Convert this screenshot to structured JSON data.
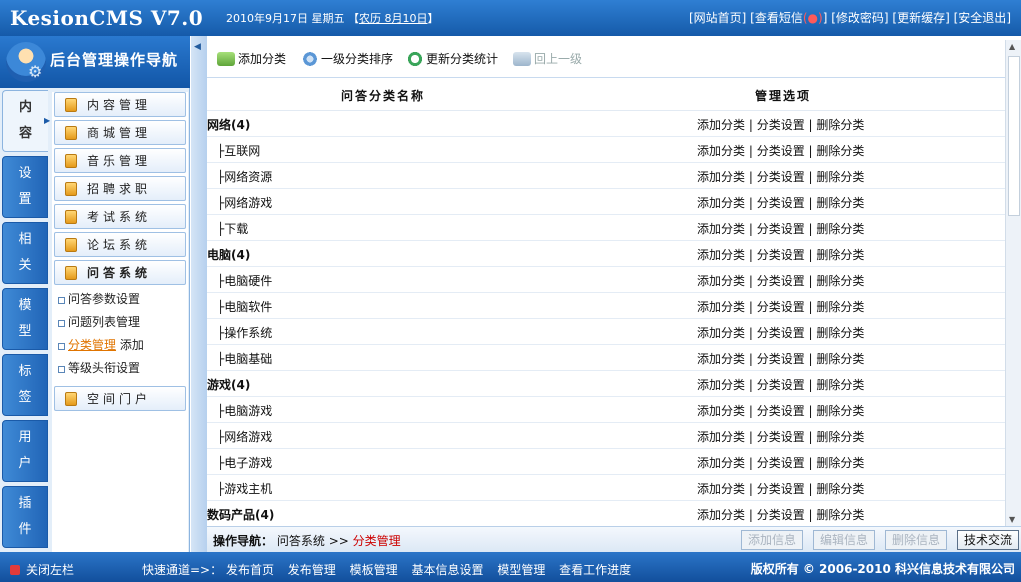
{
  "header": {
    "logo": "KesionCMS V7.0",
    "date": "2010年9月17日 星期五",
    "lunar_open": "【",
    "lunar": "农历 8月10日",
    "lunar_close": "】",
    "links": [
      "网站首页",
      "查看短信",
      "修改密码",
      "更新缓存",
      "安全退出"
    ]
  },
  "nav": {
    "title": "后台管理操作导航",
    "tabs": [
      {
        "top": "内",
        "bottom": "容"
      },
      {
        "top": "设",
        "bottom": "置"
      },
      {
        "top": "相",
        "bottom": "关"
      },
      {
        "top": "模",
        "bottom": "型"
      },
      {
        "top": "标",
        "bottom": "签"
      },
      {
        "top": "用",
        "bottom": "户"
      },
      {
        "top": "插",
        "bottom": "件"
      }
    ],
    "menu": [
      "内容管理",
      "商城管理",
      "音乐管理",
      "招聘求职",
      "考试系统",
      "论坛系统",
      "问答系统"
    ],
    "submenu": [
      "问答参数设置",
      "问题列表管理",
      "分类管理",
      "添加",
      "等级头衔设置"
    ],
    "menu_last": "空间门户"
  },
  "toolbar": {
    "add": "添加分类",
    "sort": "一级分类排序",
    "refresh": "更新分类统计",
    "up": "回上一级",
    "colors": {
      "add": "#7cc14a",
      "sort": "#5b97d6",
      "refresh": "#3aa55a",
      "up": "#9db5cc"
    }
  },
  "table": {
    "col_name": "问答分类名称",
    "col_ops": "管理选项",
    "op_add": "添加分类",
    "op_set": "分类设置",
    "op_del": "删除分类",
    "rows": [
      {
        "type": "parent",
        "name": "网络(4)"
      },
      {
        "type": "child",
        "name": "├互联网"
      },
      {
        "type": "child",
        "name": "├网络资源"
      },
      {
        "type": "child",
        "name": "├网络游戏"
      },
      {
        "type": "child",
        "name": "├下载"
      },
      {
        "type": "parent",
        "name": "电脑(4)"
      },
      {
        "type": "child",
        "name": "├电脑硬件"
      },
      {
        "type": "child",
        "name": "├电脑软件"
      },
      {
        "type": "child",
        "name": "├操作系统"
      },
      {
        "type": "child",
        "name": "├电脑基础"
      },
      {
        "type": "parent",
        "name": "游戏(4)"
      },
      {
        "type": "child",
        "name": "├电脑游戏"
      },
      {
        "type": "child",
        "name": "├网络游戏"
      },
      {
        "type": "child",
        "name": "├电子游戏"
      },
      {
        "type": "child",
        "name": "├游戏主机"
      },
      {
        "type": "parent",
        "name": "数码产品(4)"
      }
    ]
  },
  "actionbar": {
    "label": "操作导航：",
    "path": "问答系统",
    "sep": ">>",
    "current": "分类管理",
    "buttons": [
      "添加信息",
      "编辑信息",
      "删除信息",
      "技术交流"
    ]
  },
  "footer": {
    "close": "关闭左栏",
    "quick_label": "快速通道=>：",
    "quick": [
      "发布首页",
      "发布管理",
      "模板管理",
      "基本信息设置",
      "模型管理",
      "查看工作进度"
    ],
    "copyright": "版权所有 © 2006-2010 科兴信息技术有限公司"
  }
}
